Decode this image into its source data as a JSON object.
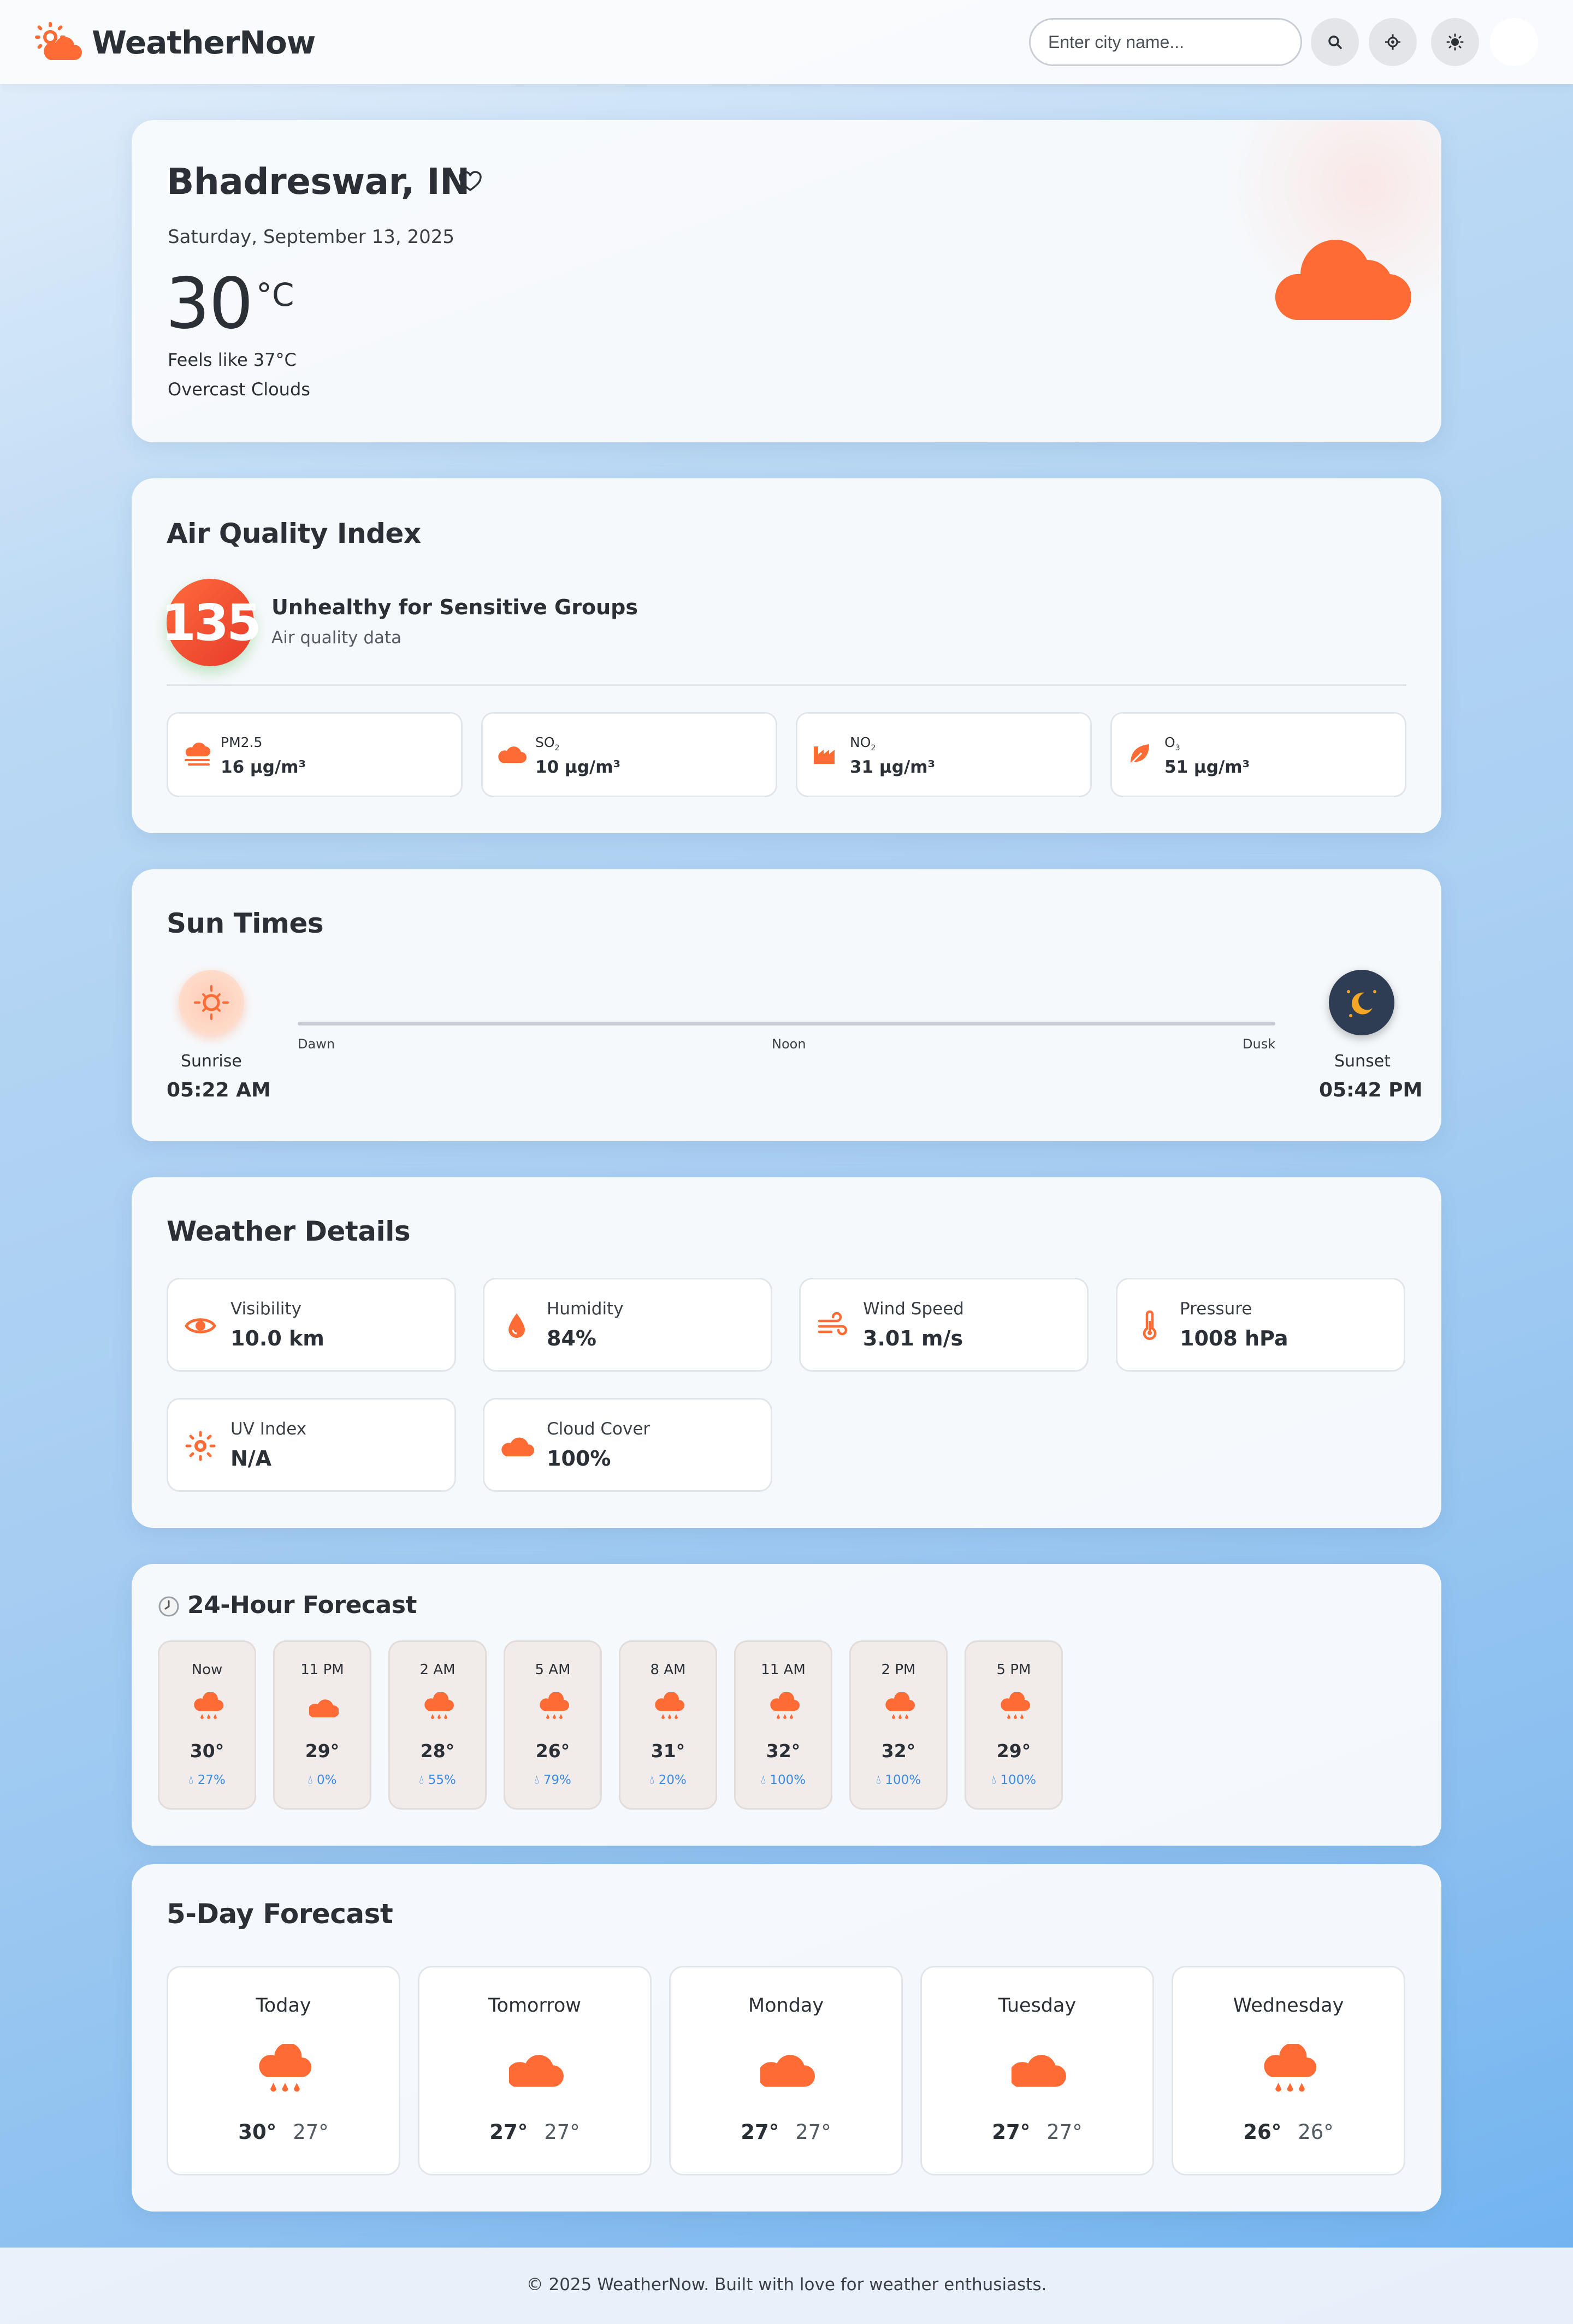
{
  "header": {
    "brand": "WeatherNow",
    "search_placeholder": "Enter city name...",
    "buttons": [
      "search-icon",
      "location-icon",
      "theme-icon"
    ]
  },
  "current": {
    "city": "Bhadreswar, IN",
    "date": "Saturday, September 13, 2025",
    "temp": "30",
    "unit": "°C",
    "feels_like": "Feels like 37°C",
    "condition": "Overcast Clouds",
    "icon": "cloud-icon"
  },
  "aqi": {
    "title": "Air Quality Index",
    "value": "135",
    "status": "Unhealthy for Sensitive Groups",
    "subtitle": "Air quality data",
    "pollutants": [
      {
        "name": "PM2.5",
        "sub": "",
        "value": "16 µg/m³",
        "icon": "fog-cloud-icon"
      },
      {
        "name": "SO",
        "sub": "2",
        "value": "10 µg/m³",
        "icon": "cloud-icon"
      },
      {
        "name": "NO",
        "sub": "2",
        "value": "31 µg/m³",
        "icon": "factory-icon"
      },
      {
        "name": "O",
        "sub": "3",
        "value": "51 µg/m³",
        "icon": "leaf-icon"
      }
    ]
  },
  "sun": {
    "title": "Sun Times",
    "sunrise_label": "Sunrise",
    "sunrise_time": "05:22 AM",
    "sunset_label": "Sunset",
    "sunset_time": "05:42 PM",
    "track": {
      "dawn": "Dawn",
      "noon": "Noon",
      "dusk": "Dusk"
    }
  },
  "details": {
    "title": "Weather Details",
    "items": [
      {
        "name": "Visibility",
        "value": "10.0 km",
        "icon": "eye-icon"
      },
      {
        "name": "Humidity",
        "value": "84%",
        "icon": "droplet-icon"
      },
      {
        "name": "Wind Speed",
        "value": "3.01 m/s",
        "icon": "wind-icon"
      },
      {
        "name": "Pressure",
        "value": "1008 hPa",
        "icon": "thermometer-icon"
      },
      {
        "name": "UV Index",
        "value": "N/A",
        "icon": "sun-icon"
      },
      {
        "name": "Cloud Cover",
        "value": "100%",
        "icon": "cloud-icon"
      }
    ]
  },
  "hourly": {
    "title": "24-Hour Forecast",
    "title_icon": "clock-icon",
    "hours": [
      {
        "time": "Now",
        "temp": "30°",
        "pop": "27%",
        "icon": "rain-icon"
      },
      {
        "time": "11 PM",
        "temp": "29°",
        "pop": "0%",
        "icon": "cloud-icon"
      },
      {
        "time": "2 AM",
        "temp": "28°",
        "pop": "55%",
        "icon": "rain-icon"
      },
      {
        "time": "5 AM",
        "temp": "26°",
        "pop": "79%",
        "icon": "rain-icon"
      },
      {
        "time": "8 AM",
        "temp": "31°",
        "pop": "20%",
        "icon": "rain-icon"
      },
      {
        "time": "11 AM",
        "temp": "32°",
        "pop": "100%",
        "icon": "rain-icon"
      },
      {
        "time": "2 PM",
        "temp": "32°",
        "pop": "100%",
        "icon": "rain-icon"
      },
      {
        "time": "5 PM",
        "temp": "29°",
        "pop": "100%",
        "icon": "rain-icon"
      }
    ]
  },
  "daily": {
    "title": "5-Day Forecast",
    "days": [
      {
        "name": "Today",
        "hi": "30°",
        "lo": "27°",
        "icon": "rain-icon"
      },
      {
        "name": "Tomorrow",
        "hi": "27°",
        "lo": "27°",
        "icon": "cloud-icon"
      },
      {
        "name": "Monday",
        "hi": "27°",
        "lo": "27°",
        "icon": "cloud-icon"
      },
      {
        "name": "Tuesday",
        "hi": "27°",
        "lo": "27°",
        "icon": "cloud-icon"
      },
      {
        "name": "Wednesday",
        "hi": "26°",
        "lo": "26°",
        "icon": "rain-icon"
      }
    ]
  },
  "footer": {
    "text": "© 2025 WeatherNow. Built with love for weather enthusiasts."
  },
  "colors": {
    "accent": "#ff6b35",
    "rain": "#3a8be6",
    "aqi": "#e63a2a"
  }
}
